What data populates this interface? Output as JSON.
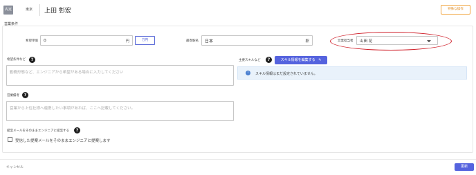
{
  "header": {
    "status": "内定",
    "area": "東京",
    "name": "上田 彰宏",
    "special_action": "特殊な操作"
  },
  "section_title": "営業条件",
  "form": {
    "desired_price": {
      "label": "希望単価",
      "value": "0",
      "unit": "円",
      "button": "万円"
    },
    "nearest_station": {
      "label": "最寄駅名",
      "value": "日本",
      "suffix": "駅"
    },
    "sales_rep": {
      "label": "営業担当者",
      "value": "山田 花"
    },
    "desired_conditions": {
      "label": "希望条件など",
      "placeholder": "勤務形態など、エンジニアから希望がある場合に入力してください"
    },
    "main_skills": {
      "label": "主要スキルなど",
      "button": "スキル情報を編集する",
      "info": "スキル情報はまだ設定されていません。"
    },
    "sales_notes": {
      "label": "営業備考",
      "placeholder": "営業から上位社様へ連携したい事項があれば、ここへ記載してください。"
    },
    "proposal_mail": {
      "label": "提案メールをそのままエンジニアに提案する",
      "checkbox_label": "受信した提案メールをそのままエンジニアに提案します"
    }
  },
  "footer": {
    "cancel": "キャンセル",
    "save": "更新"
  },
  "colors": {
    "accent": "#5563de",
    "warning": "#f0a33c",
    "highlight_oval": "#d0202a"
  }
}
